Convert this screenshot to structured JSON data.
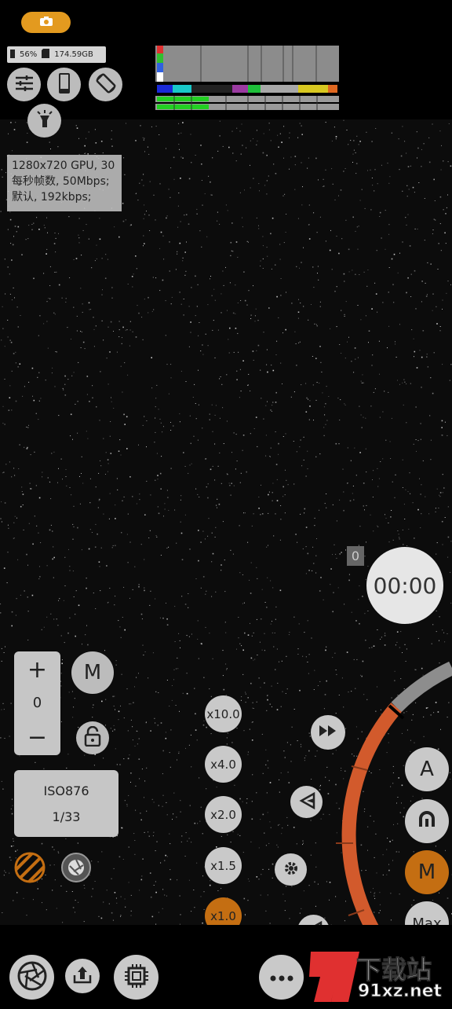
{
  "status": {
    "battery": "56%",
    "storage": "174.59GB"
  },
  "video_info": {
    "line1": "1280x720 GPU, 30",
    "line2": "每秒帧数, 50Mbps;",
    "line3": "默认, 192kbps;"
  },
  "exposure": {
    "plus": "+",
    "value": "0",
    "minus": "−",
    "mode_label": "M"
  },
  "iso": {
    "iso_value": "ISO876",
    "shutter": "1/33"
  },
  "zoom_levels": [
    {
      "label": "x10.0",
      "active": false
    },
    {
      "label": "x4.0",
      "active": false
    },
    {
      "label": "x2.0",
      "active": false
    },
    {
      "label": "x1.5",
      "active": false
    },
    {
      "label": "x1.0",
      "active": true
    }
  ],
  "modes": [
    "A",
    "",
    "M",
    "Max"
  ],
  "record": {
    "counter": "0",
    "timer": "00:00"
  },
  "watermark": {
    "brand_cn": "下载站",
    "brand_url": "91xz.net"
  },
  "colors": {
    "accent": "#e39a1f",
    "active_zoom": "#c46e12",
    "dial": "#d25a2c"
  },
  "icons": [
    "camera-icon",
    "sliders-icon",
    "phone-icon",
    "rotate-icon",
    "flashlight-icon",
    "lock-icon",
    "fast-forward-icon",
    "rewind-icon",
    "gear-icon",
    "aperture-icon",
    "upload-lock-icon",
    "chip-icon",
    "more-icon"
  ]
}
